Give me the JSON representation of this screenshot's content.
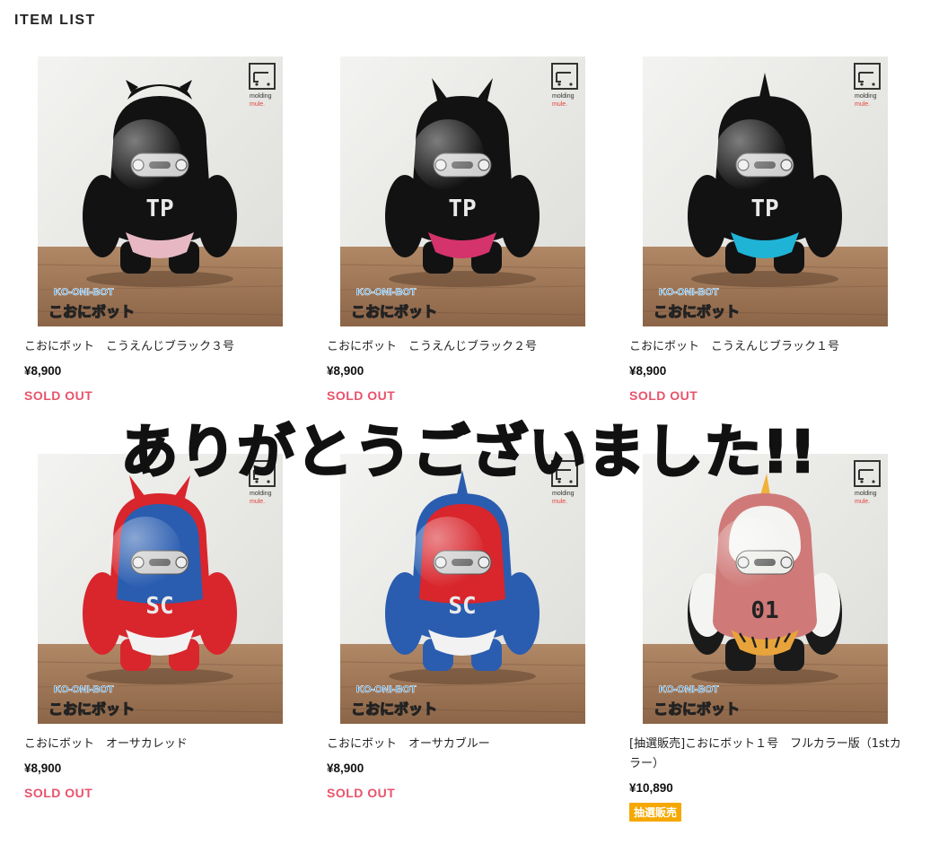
{
  "section_title": "ITEM LIST",
  "overlay_message": "ありがとうございました!!",
  "brand": {
    "logo_line1": "molding",
    "logo_line2": "mule."
  },
  "product_overlay": {
    "en": "KO-ONI-BOT",
    "jp": "こおにボット"
  },
  "items": [
    {
      "name": "こおにボット　こうえんじブラック３号",
      "price": "¥8,900",
      "status": "SOLD OUT",
      "chest": "TP",
      "body": "#121212",
      "visor": "#1a1a1a",
      "pants": "#e7b8c4",
      "horn": "#121212"
    },
    {
      "name": "こおにボット　こうえんじブラック２号",
      "price": "¥8,900",
      "status": "SOLD OUT",
      "chest": "TP",
      "body": "#121212",
      "visor": "#1a1a1a",
      "pants": "#d4336b",
      "horn": "#121212"
    },
    {
      "name": "こおにボット　こうえんじブラック１号",
      "price": "¥8,900",
      "status": "SOLD OUT",
      "chest": "TP",
      "body": "#121212",
      "visor": "#1a1a1a",
      "pants": "#1fb3d6",
      "horn": "#121212"
    },
    {
      "name": "こおにボット　オーサカレッド",
      "price": "¥8,900",
      "status": "SOLD OUT",
      "chest": "SC",
      "body": "#d8262c",
      "visor": "#2a5db0",
      "pants": "#f2f2f2",
      "horn": "#d8262c"
    },
    {
      "name": "こおにボット　オーサカブルー",
      "price": "¥8,900",
      "status": "SOLD OUT",
      "chest": "SC",
      "body": "#2a5db0",
      "visor": "#d8262c",
      "pants": "#f2f2f2",
      "horn": "#2a5db0"
    },
    {
      "name": "[抽選販売]こおにボット１号　フルカラー版（1stカラー）",
      "price": "¥10,890",
      "status": "抽選販売",
      "chest": "01",
      "body": "#f4f4f2",
      "visor": "#cf7a78",
      "pants": "#e8a43a",
      "horn": "#f0b23a"
    }
  ],
  "colors": {
    "sold_out": "#e8536b",
    "lottery_badge": "#f5a800",
    "overlay_text": "#111111"
  }
}
